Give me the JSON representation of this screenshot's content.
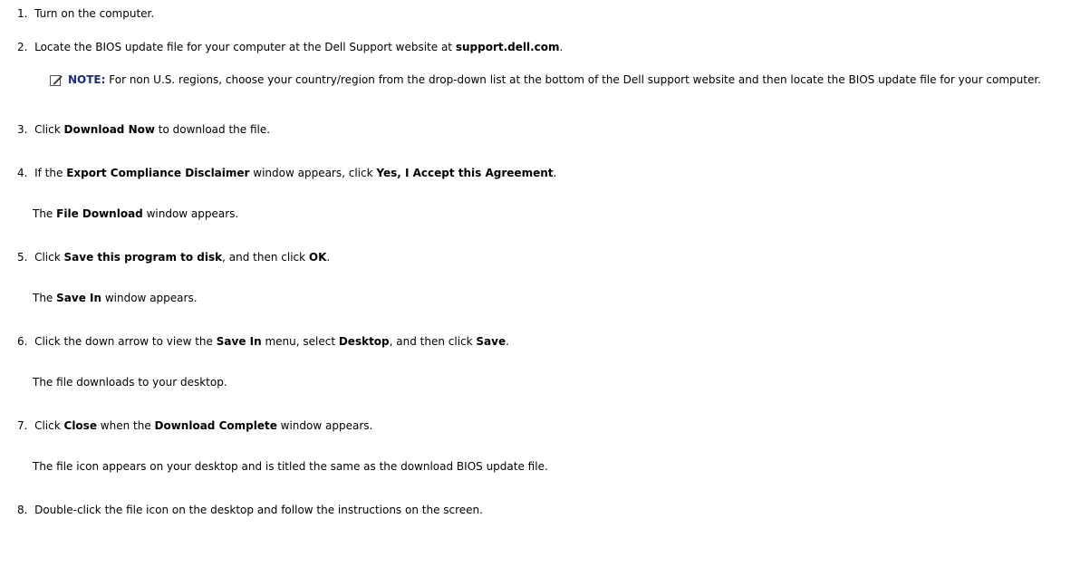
{
  "steps": [
    {
      "num": "1.",
      "parts": [
        {
          "t": "Turn on the computer."
        }
      ]
    },
    {
      "num": "2.",
      "parts": [
        {
          "t": "Locate the BIOS update file for your computer at the Dell Support website at "
        },
        {
          "t": "support.dell.com",
          "b": true
        },
        {
          "t": "."
        }
      ]
    },
    {
      "num": "3.",
      "parts": [
        {
          "t": "Click "
        },
        {
          "t": "Download Now",
          "b": true
        },
        {
          "t": " to download the file."
        }
      ]
    },
    {
      "num": "4.",
      "parts": [
        {
          "t": "If the "
        },
        {
          "t": "Export Compliance Disclaimer",
          "b": true
        },
        {
          "t": " window appears, click "
        },
        {
          "t": "Yes, I Accept this Agreement",
          "b": true
        },
        {
          "t": "."
        }
      ]
    },
    {
      "num": "5.",
      "parts": [
        {
          "t": "Click "
        },
        {
          "t": "Save this program to disk",
          "b": true
        },
        {
          "t": ", and then click "
        },
        {
          "t": "OK",
          "b": true
        },
        {
          "t": "."
        }
      ]
    },
    {
      "num": "6.",
      "parts": [
        {
          "t": "Click the down arrow to view the "
        },
        {
          "t": "Save In",
          "b": true
        },
        {
          "t": " menu, select "
        },
        {
          "t": "Desktop",
          "b": true
        },
        {
          "t": ", and then click "
        },
        {
          "t": "Save",
          "b": true
        },
        {
          "t": "."
        }
      ]
    },
    {
      "num": "7.",
      "parts": [
        {
          "t": "Click "
        },
        {
          "t": "Close",
          "b": true
        },
        {
          "t": " when the "
        },
        {
          "t": "Download Complete",
          "b": true
        },
        {
          "t": " window appears."
        }
      ]
    },
    {
      "num": "8.",
      "parts": [
        {
          "t": "Double-click the file icon on the desktop and follow the instructions on the screen."
        }
      ]
    }
  ],
  "note": {
    "label": "NOTE:",
    "text": " For non U.S. regions, choose your country/region from the drop-down list at the bottom of the Dell support website and then locate the BIOS update file for your computer.",
    "icon": "pencil-note-icon",
    "label_color": "#1c2a8c"
  },
  "subtexts": [
    {
      "parts": [
        {
          "t": "The "
        },
        {
          "t": "File Download",
          "b": true
        },
        {
          "t": " window appears."
        }
      ]
    },
    {
      "parts": [
        {
          "t": "The "
        },
        {
          "t": "Save In",
          "b": true
        },
        {
          "t": " window appears."
        }
      ]
    },
    {
      "parts": [
        {
          "t": "The file downloads to your desktop."
        }
      ]
    },
    {
      "parts": [
        {
          "t": "The file icon appears on your desktop and is titled the same as the download BIOS update file."
        }
      ]
    }
  ]
}
